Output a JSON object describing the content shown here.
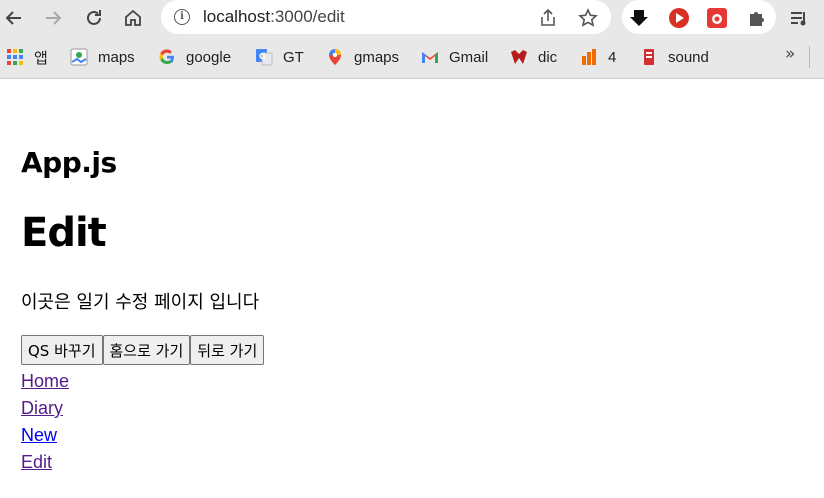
{
  "browser": {
    "url_host": "localhost",
    "url_path": ":3000/edit"
  },
  "bookmarks": [
    {
      "label": "앱",
      "icon": "apps-grid-icon"
    },
    {
      "label": "maps",
      "icon": "maps-icon"
    },
    {
      "label": "google",
      "icon": "google-icon"
    },
    {
      "label": "GT",
      "icon": "google-translate-icon"
    },
    {
      "label": "gmaps",
      "icon": "gmaps-pin-icon"
    },
    {
      "label": "Gmail",
      "icon": "gmail-icon"
    },
    {
      "label": "dic",
      "icon": "dictionary-icon"
    },
    {
      "label": "4",
      "icon": "bars-icon"
    },
    {
      "label": "sound",
      "icon": "sound-icon"
    }
  ],
  "bookmarks_more": "»",
  "page": {
    "app_title": "App.js",
    "heading": "Edit",
    "description": "이곳은 일기 수정 페이지 입니다",
    "buttons": {
      "qs": "QS 바꾸기",
      "home": "홈으로 가기",
      "back": "뒤로 가기"
    },
    "links": {
      "home": "Home",
      "diary": "Diary",
      "new": "New",
      "edit": "Edit"
    }
  },
  "colors": {
    "chrome_bg": "#e8e8e8",
    "link_visited": "#551a8b",
    "link_unvisited": "#0000ee"
  }
}
